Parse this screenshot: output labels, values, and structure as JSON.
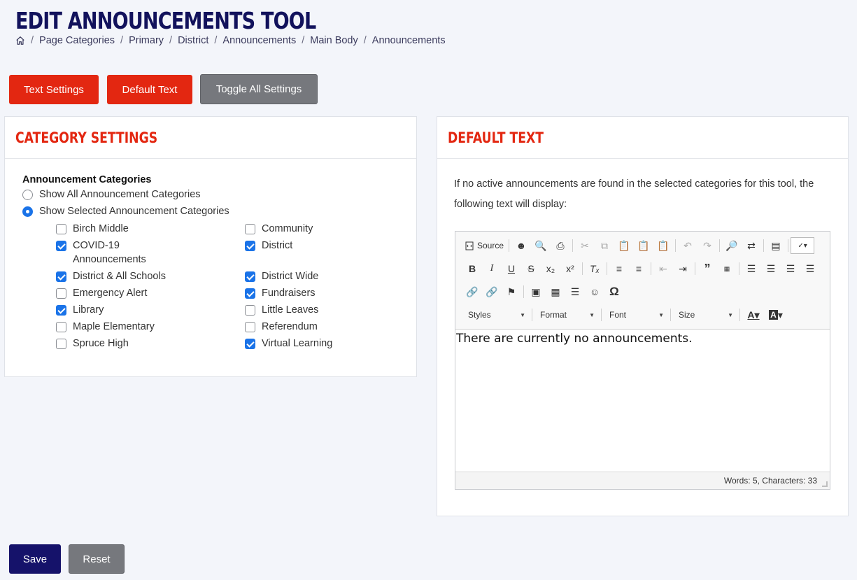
{
  "page": {
    "title": "EDIT ANNOUNCEMENTS TOOL"
  },
  "breadcrumb": [
    "Page Categories",
    "Primary",
    "District",
    "Announcements",
    "Main Body",
    "Announcements"
  ],
  "top_buttons": {
    "text_settings": "Text Settings",
    "default_text": "Default Text",
    "toggle_all": "Toggle All Settings"
  },
  "category_settings": {
    "title": "CATEGORY SETTINGS",
    "section_label": "Announcement Categories",
    "radio_all": "Show All Announcement Categories",
    "radio_selected": "Show Selected Announcement Categories",
    "selected_mode": "selected",
    "left_column": [
      {
        "label": "Birch Middle",
        "checked": false
      },
      {
        "label": "COVID-19 Announcements",
        "checked": true
      },
      {
        "label": "District & All Schools",
        "checked": true
      },
      {
        "label": "Emergency Alert",
        "checked": false
      },
      {
        "label": "Library",
        "checked": true
      },
      {
        "label": "Maple Elementary",
        "checked": false
      },
      {
        "label": "Spruce High",
        "checked": false
      }
    ],
    "right_column": [
      {
        "label": "Community",
        "checked": false
      },
      {
        "label": "District",
        "checked": true
      },
      {
        "label": "District Wide",
        "checked": true
      },
      {
        "label": "Fundraisers",
        "checked": true
      },
      {
        "label": "Little Leaves",
        "checked": false
      },
      {
        "label": "Referendum",
        "checked": false
      },
      {
        "label": "Virtual Learning",
        "checked": true
      }
    ]
  },
  "default_text": {
    "title": "DEFAULT TEXT",
    "description": "If no active announcements are found in the selected categories for this tool, the following text will display:",
    "editor": {
      "source_label": "Source",
      "styles_label": "Styles",
      "format_label": "Format",
      "font_label": "Font",
      "size_label": "Size",
      "content": "There are currently no announcements.",
      "word_count": "Words: 5, Characters: 33"
    }
  },
  "bottom_buttons": {
    "save": "Save",
    "reset": "Reset"
  },
  "colors": {
    "accent_red": "#e32711",
    "navy": "#15126a",
    "checkbox_blue": "#1a73e8"
  }
}
